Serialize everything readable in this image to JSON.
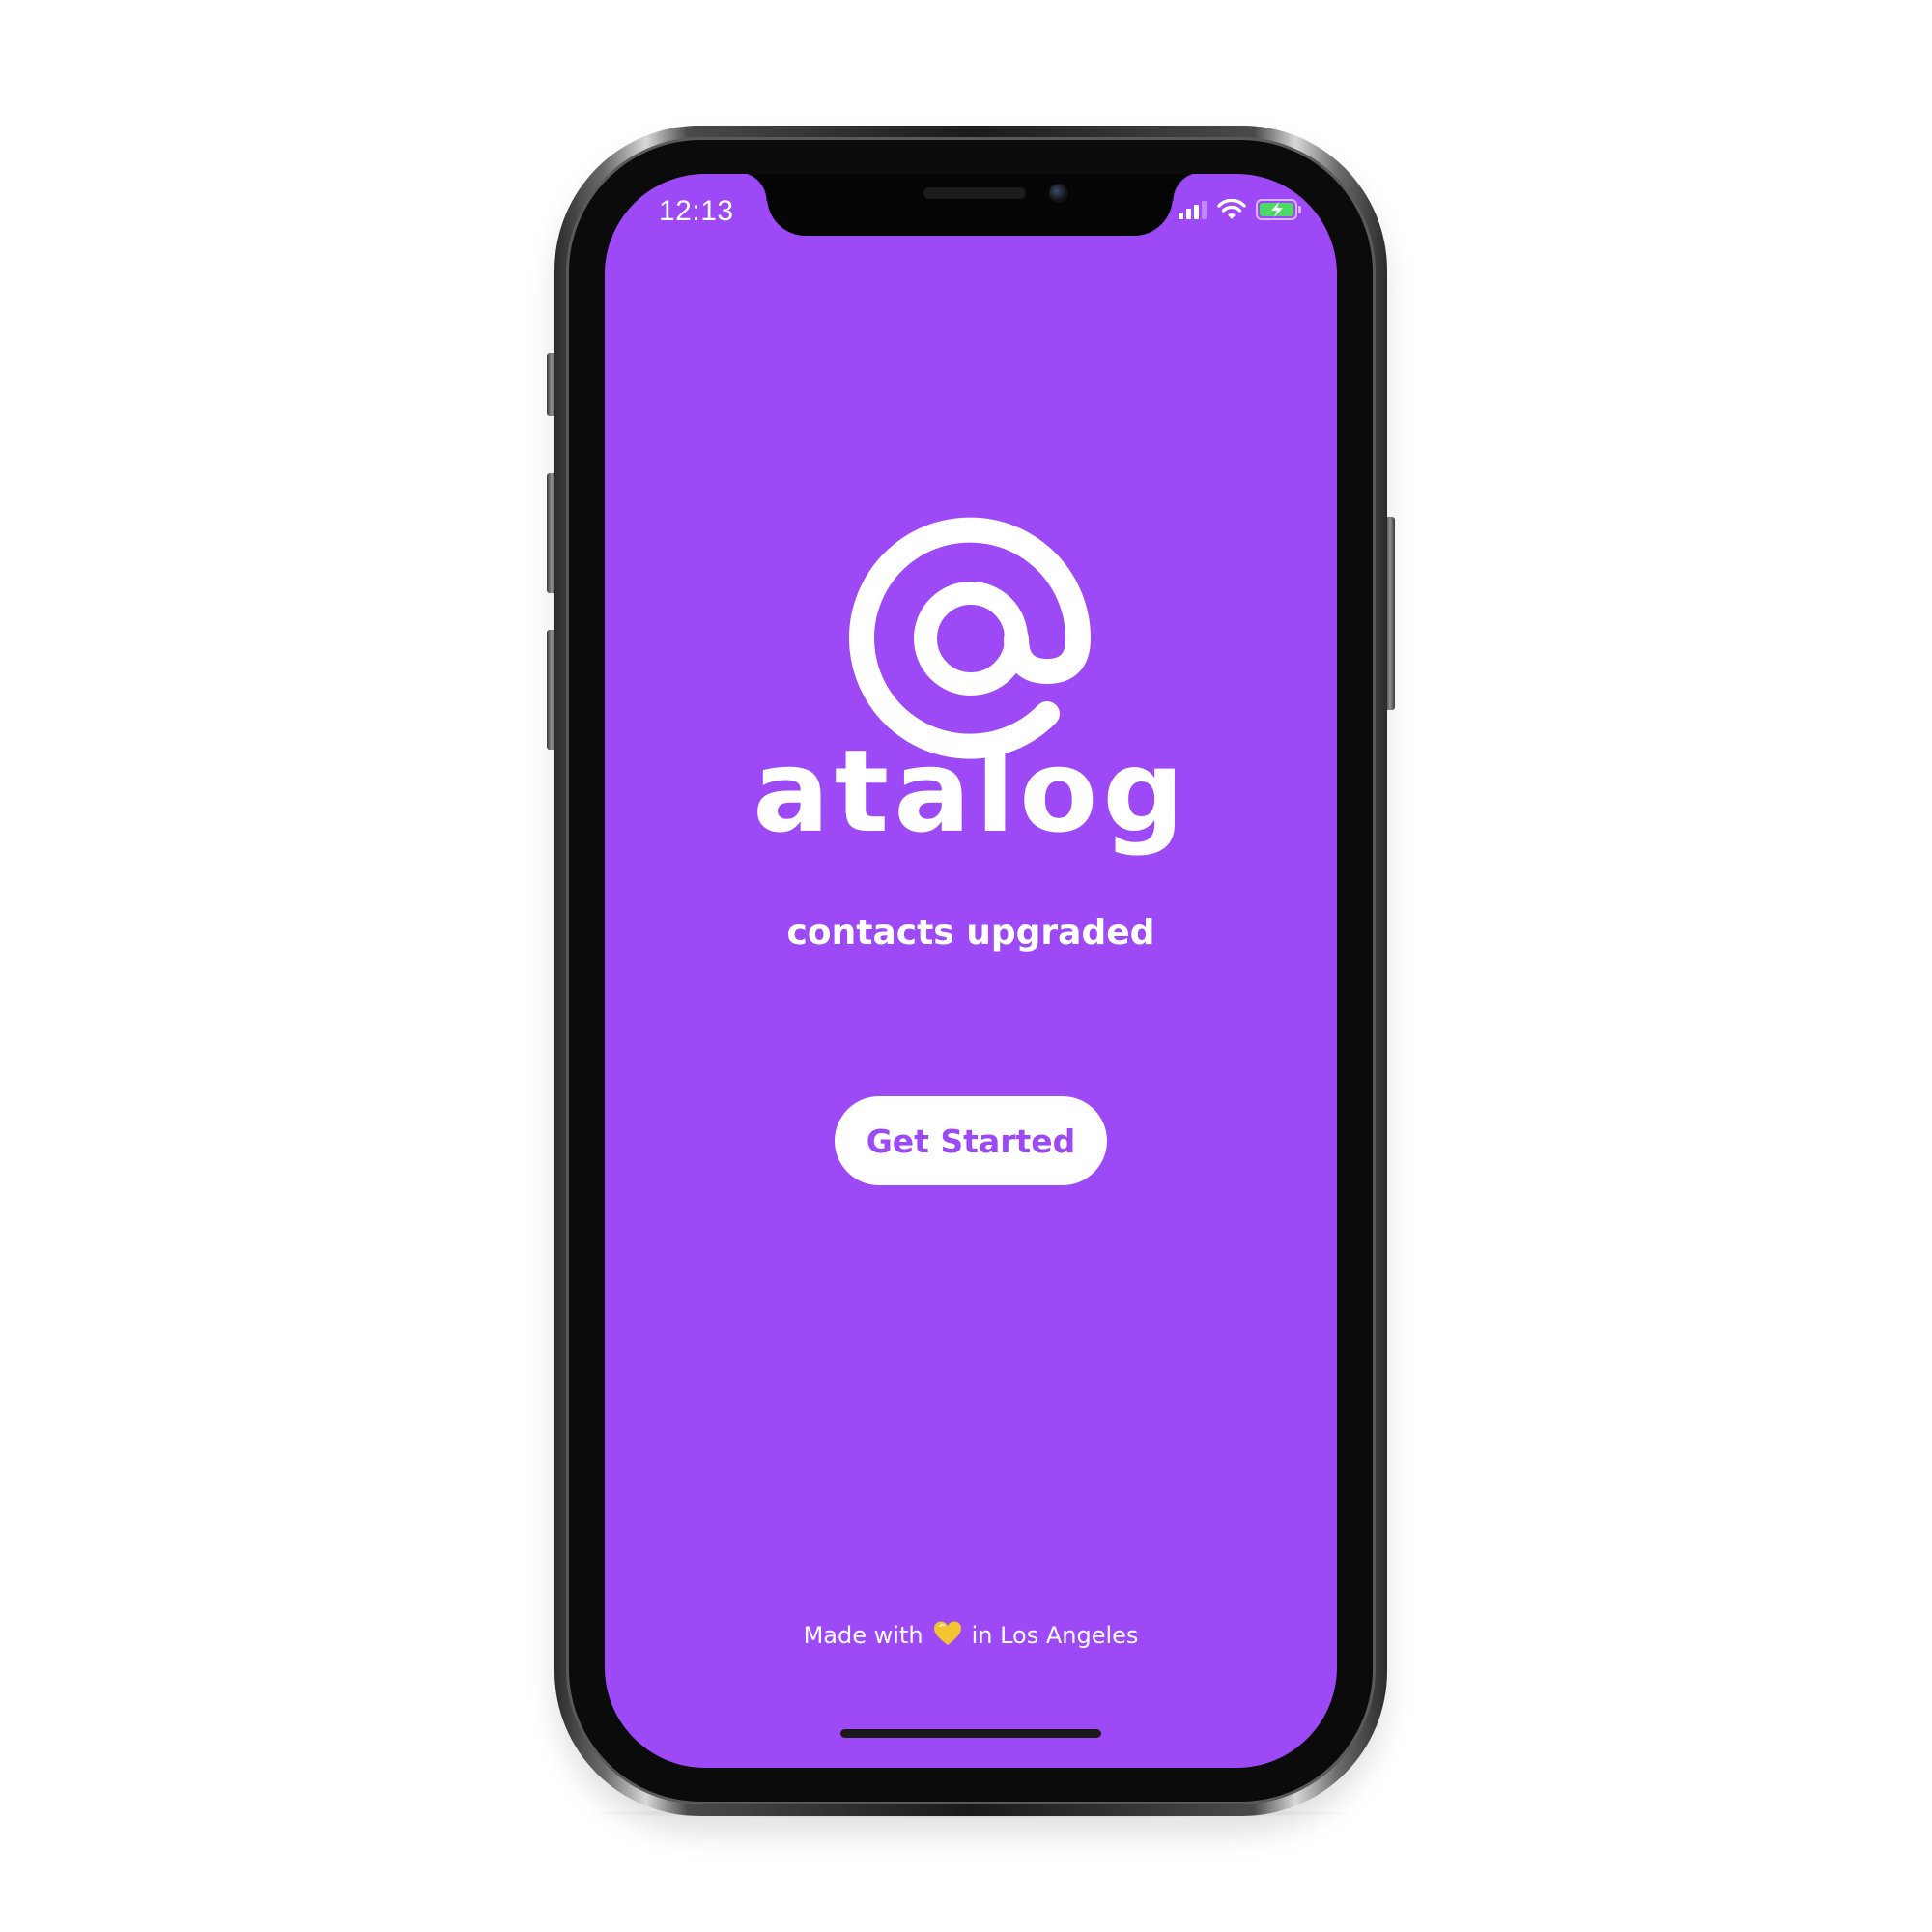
{
  "status_bar": {
    "time": "12:13",
    "icons": [
      "signal-icon",
      "wifi-icon",
      "battery-charging-icon"
    ]
  },
  "app": {
    "brand_name": "atalog",
    "tagline": "contacts upgraded",
    "logo_icon": "at-sign-logo-icon",
    "primary_button_label": "Get Started"
  },
  "footer": {
    "made_with": "Made with",
    "heart_icon": "yellow-heart-icon",
    "location": "in Los Angeles"
  },
  "colors": {
    "background": "#9d4af6",
    "foreground": "#ffffff",
    "button_text": "#9d4af6",
    "heart": "#f4c430",
    "battery_fill": "#4cd964"
  }
}
